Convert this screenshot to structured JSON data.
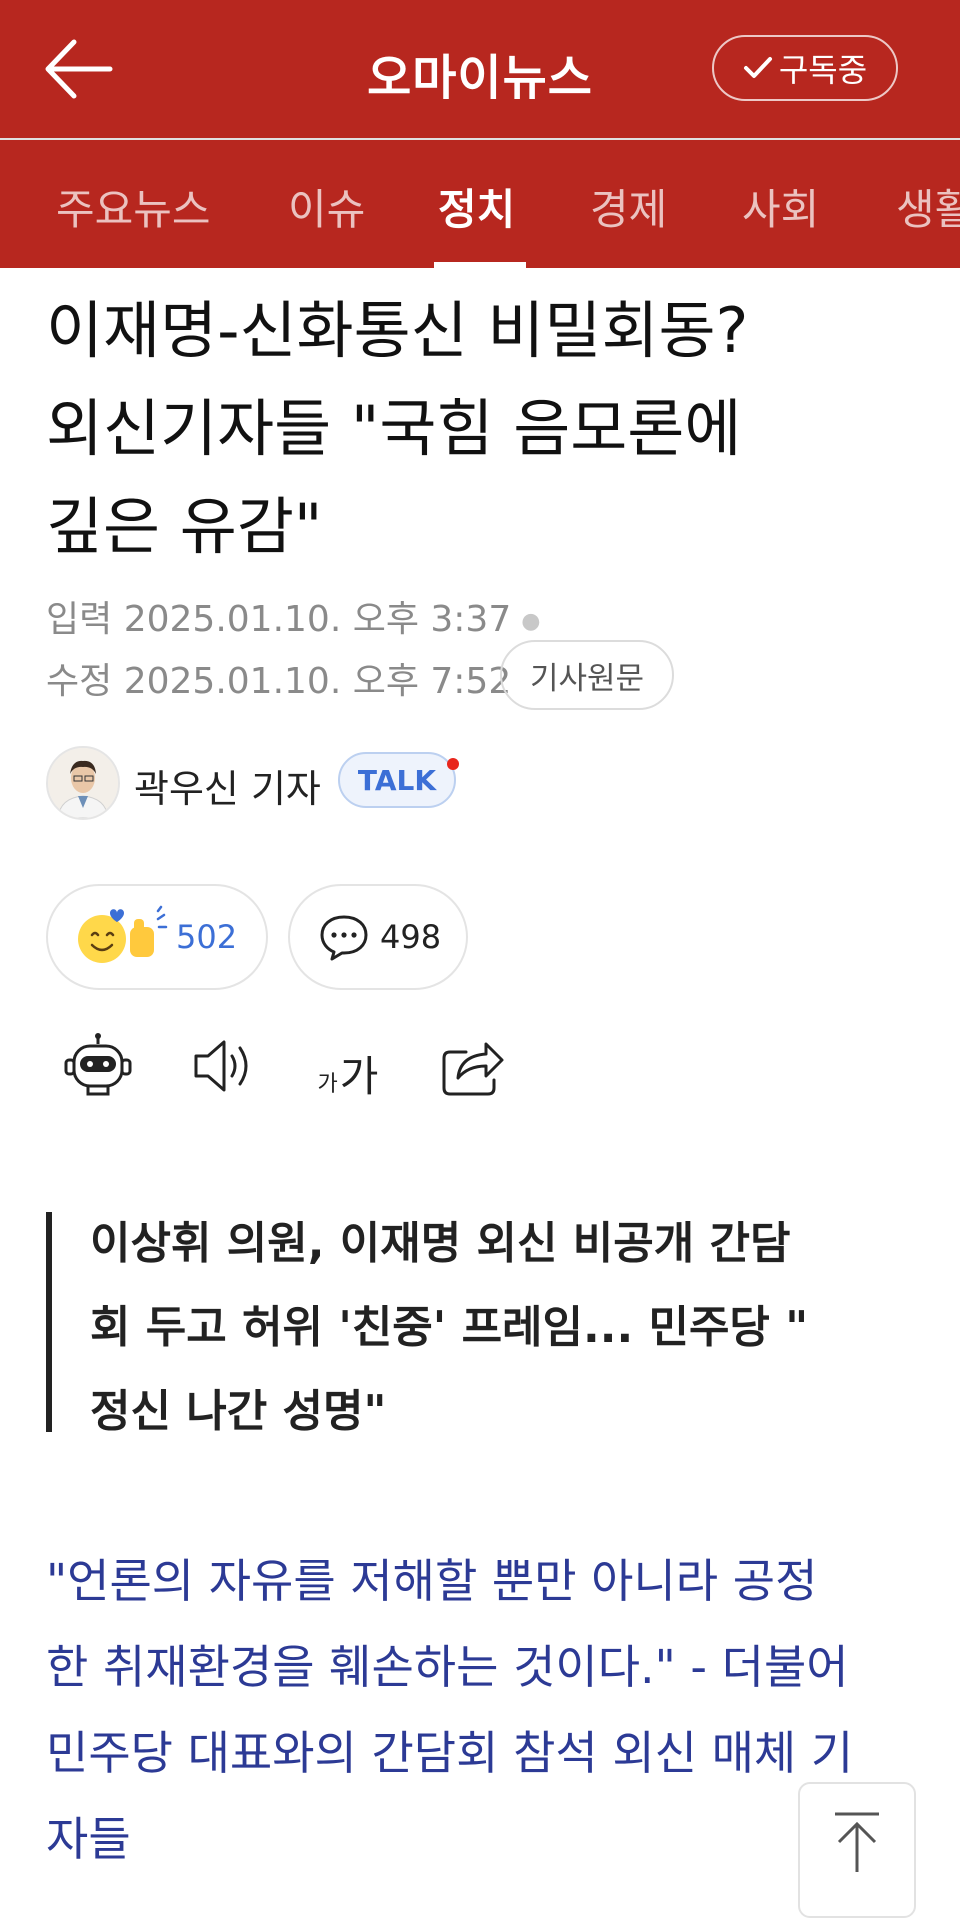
{
  "header": {
    "brand": "오마이뉴스",
    "subscribe_label": "구독중"
  },
  "tabs": [
    {
      "label": "주요뉴스",
      "active": false
    },
    {
      "label": "이슈",
      "active": false
    },
    {
      "label": "정치",
      "active": true
    },
    {
      "label": "경제",
      "active": false
    },
    {
      "label": "사회",
      "active": false
    },
    {
      "label": "생활",
      "active": false
    }
  ],
  "article": {
    "headline_lines": [
      "이재명-신화통신 비밀회동?",
      "외신기자들 \"국힘 음모론에",
      "깊은 유감\""
    ],
    "input_label": "입력",
    "input_time": "2025.01.10. 오후 3:37",
    "edit_label": "수정",
    "edit_time": "2025.01.10. 오후 7:52",
    "original_link": "기사원문",
    "reporter": "곽우신 기자",
    "talk_label": "TALK",
    "likes": "502",
    "comments": "498",
    "font_size_icon_small": "가",
    "font_size_icon_large": "가",
    "summary_lines": [
      "이상휘 의원, 이재명 외신 비공개 간담",
      "회 두고 허위 '친중' 프레임... 민주당 \"",
      "정신 나간 성명\""
    ],
    "lead_lines": [
      "\"언론의 자유를 저해할 뿐만 아니라 공정",
      "한 취재환경을 훼손하는 것이다.\" - 더불어",
      "민주당 대표와의 간담회 참석 외신 매체 기",
      "자들"
    ]
  },
  "colors": {
    "brand_red": "#b7271f",
    "lead_text": "#2c3a95",
    "talk_blue": "#3c6fd6"
  }
}
